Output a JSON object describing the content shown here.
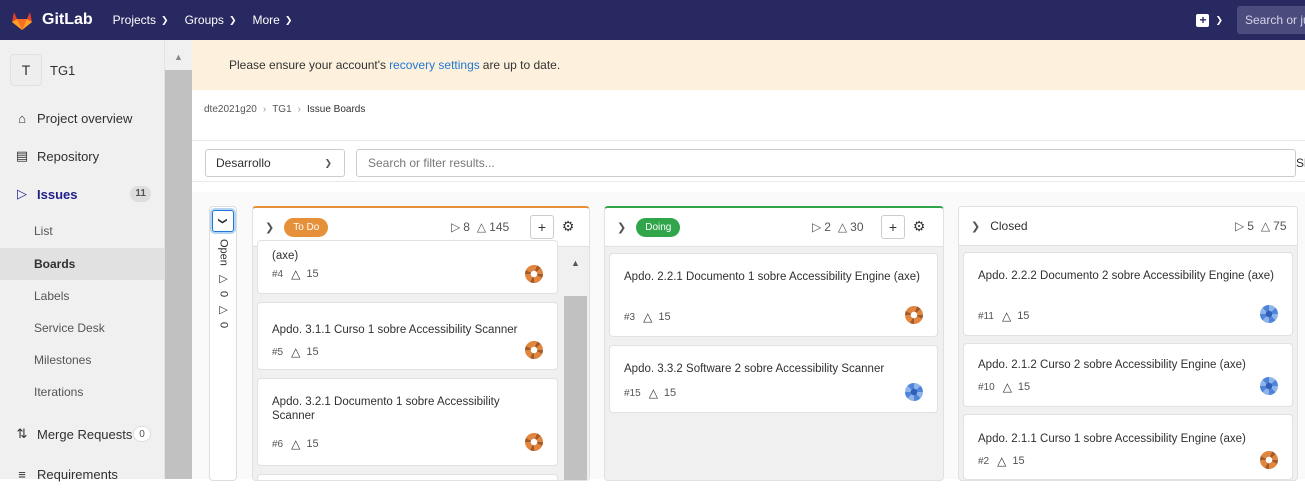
{
  "topbar": {
    "brand": "GitLab",
    "nav": [
      {
        "label": "Projects"
      },
      {
        "label": "Groups"
      },
      {
        "label": "More"
      }
    ],
    "search_placeholder": "Search or ju"
  },
  "sidebar": {
    "avatar_letter": "T",
    "project_name": "TG1",
    "items": [
      {
        "label": "Project overview",
        "icon": "home-icon"
      },
      {
        "label": "Repository",
        "icon": "document-icon"
      },
      {
        "label": "Issues",
        "icon": "issues-icon",
        "count": "11"
      },
      {
        "label": "Merge Requests",
        "icon": "merge-request-icon",
        "count": "0"
      },
      {
        "label": "Requirements",
        "icon": "requirements-icon"
      }
    ],
    "issues_sub": [
      "List",
      "Boards",
      "Labels",
      "Service Desk",
      "Milestones",
      "Iterations"
    ]
  },
  "alert": {
    "before": "Please ensure your account's",
    "link": "recovery settings",
    "after": "are up to date."
  },
  "breadcrumb": [
    "dte2021g20",
    "TG1",
    "Issue Boards"
  ],
  "filter": {
    "board": "Desarrollo",
    "placeholder": "Search or filter results...",
    "sort_partial": "Sl"
  },
  "open_list": {
    "label": "Open",
    "issue_count": "0",
    "weight": "0"
  },
  "lists": [
    {
      "label": "To Do",
      "color": "#e6913a",
      "issues": "8",
      "weight": "145",
      "cards": [
        {
          "title": "(axe)",
          "id": "#4",
          "weight": "15",
          "avatar": "orange"
        },
        {
          "title": "Apdo. 3.1.1 Curso 1 sobre Accessibility Scanner",
          "id": "#5",
          "weight": "15",
          "avatar": "orange"
        },
        {
          "title": "Apdo. 3.2.1 Documento 1 sobre Accessibility Scanner",
          "id": "#6",
          "weight": "15",
          "avatar": "orange"
        }
      ]
    },
    {
      "label": "Doing",
      "color": "#31a54a",
      "issues": "2",
      "weight": "30",
      "cards": [
        {
          "title": "Apdo. 2.2.1 Documento 1 sobre Accessibility Engine (axe)",
          "id": "#3",
          "weight": "15",
          "avatar": "orange"
        },
        {
          "title": "Apdo. 3.3.2 Software 2 sobre Accessibility Scanner",
          "id": "#15",
          "weight": "15",
          "avatar": "blue"
        }
      ]
    },
    {
      "label": "Closed",
      "issues": "5",
      "weight": "75",
      "cards": [
        {
          "title": "Apdo. 2.2.2 Documento 2 sobre Accessibility Engine (axe)",
          "id": "#11",
          "weight": "15",
          "avatar": "blue"
        },
        {
          "title": "Apdo. 2.1.2 Curso 2 sobre Accessibility Engine (axe)",
          "id": "#10",
          "weight": "15",
          "avatar": "blue"
        },
        {
          "title": "Apdo. 2.1.1 Curso 1 sobre Accessibility Engine (axe)",
          "id": "#2",
          "weight": "15",
          "avatar": "orange"
        }
      ]
    }
  ]
}
